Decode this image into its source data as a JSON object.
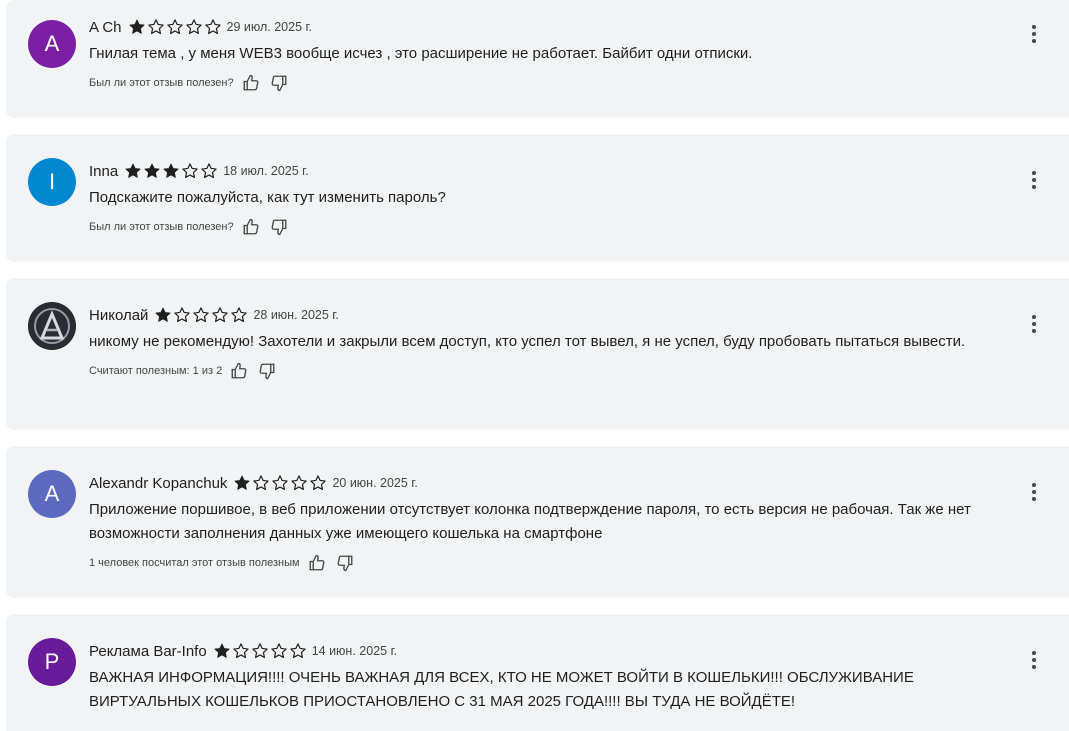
{
  "reviews": [
    {
      "avatar_letter": "A",
      "avatar_color": "#7b1fa2",
      "author": "A Ch",
      "rating": 1,
      "date": "29 июл. 2025 г.",
      "text": "Гнилая тема , у меня WEB3 вообще исчез , это расширение не работает. Байбит одни отписки.",
      "helpful": "Был ли этот отзыв полезен?"
    },
    {
      "avatar_letter": "I",
      "avatar_color": "#0288d1",
      "author": "Inna",
      "rating": 3,
      "date": "18 июл. 2025 г.",
      "text": "Подскажите пожалуйста, как тут изменить пароль?",
      "helpful": "Был ли этот отзыв полезен?"
    },
    {
      "avatar_letter": "",
      "avatar_color": "#3a3a3a",
      "author": "Николай",
      "rating": 1,
      "date": "28 июн. 2025 г.",
      "text": "никому не рекомендую! Захотели и закрыли всем доступ, кто успел тот вывел, я  не успел, буду пробовать пытаться вывести.",
      "helpful": "Считают полезным: 1 из 2"
    },
    {
      "avatar_letter": "A",
      "avatar_color": "#5c6bc0",
      "author": "Alexandr Kopanchuk",
      "rating": 1,
      "date": "20 июн. 2025 г.",
      "text": "Приложение поршивое, в веб приложении отсутствует колонка подтверждение пароля, то есть версия не рабочая. Так же нет возможности заполнения данных уже имеющего кошелька на смартфоне",
      "helpful": "1 человек посчитал этот отзыв полезным"
    },
    {
      "avatar_letter": "P",
      "avatar_color": "#6a1b9a",
      "author": "Реклама Bar-Info",
      "rating": 1,
      "date": "14 июн. 2025 г.",
      "text": "ВАЖНАЯ ИНФОРМАЦИЯ!!!! ОЧЕНЬ ВАЖНАЯ ДЛЯ ВСЕХ, КТО НЕ МОЖЕТ ВОЙТИ В КОШЕЛЬКИ!!! ОБСЛУЖИВАНИЕ ВИРТУАЛЬНЫХ КОШЕЛЬКОВ ПРИОСТАНОВЛЕНО С 31 МАЯ 2025 ГОДА!!!! ВЫ ТУДА НЕ ВОЙДЁТЕ!",
      "helpful": ""
    }
  ],
  "star_color": "#1f1f1f",
  "icons": {
    "filled_star": "star-filled-icon",
    "empty_star": "star-outline-icon",
    "thumb_up": "thumb-up-icon",
    "thumb_down": "thumb-down-icon",
    "more": "more-vert-icon"
  }
}
